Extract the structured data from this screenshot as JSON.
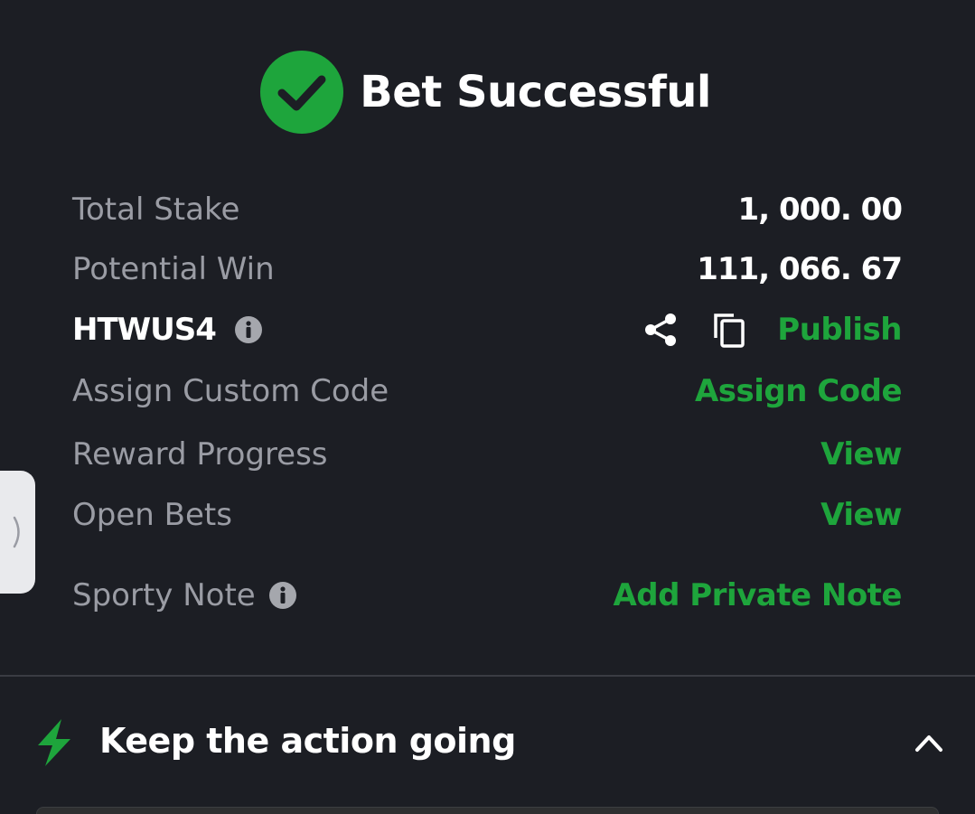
{
  "header": {
    "title": "Bet Successful",
    "icon": "check-circle-icon",
    "accent": "#1ea53c"
  },
  "summary": {
    "total_stake_label": "Total Stake",
    "total_stake_value": "1, 000. 00",
    "potential_win_label": "Potential Win",
    "potential_win_value": "111, 066. 67"
  },
  "booking": {
    "code": "HTWUS4",
    "info_icon": "info-icon",
    "share_icon": "share-icon",
    "copy_icon": "copy-icon",
    "publish_label": "Publish"
  },
  "custom_code": {
    "label": "Assign Custom Code",
    "action_label": "Assign Code"
  },
  "reward_progress": {
    "label": "Reward Progress",
    "action_label": "View"
  },
  "open_bets": {
    "label": "Open Bets",
    "action_label": "View"
  },
  "note": {
    "label": "Sporty Note",
    "info_icon": "info-icon",
    "action_label": "Add Private Note"
  },
  "section": {
    "title": "Keep the action going",
    "icon": "lightning-bolt-icon",
    "toggle_icon": "chevron-up-icon"
  },
  "side_handle": {
    "icon": "chevron-right-icon"
  },
  "colors": {
    "background": "#1c1e24",
    "link": "#1ea53c",
    "label": "#9a9ca4",
    "value": "#ffffff"
  }
}
